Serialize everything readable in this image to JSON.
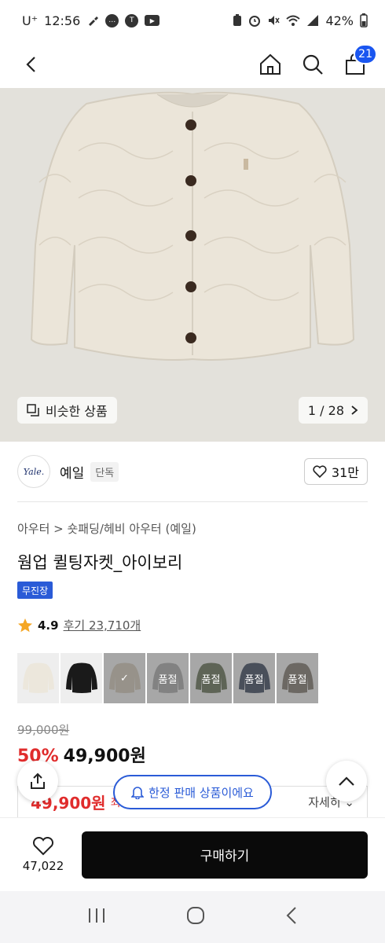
{
  "status": {
    "carrier": "U⁺",
    "time": "12:56",
    "battery": "42%",
    "icons_left": [
      "brush-icon",
      "chat-bubble-icon",
      "talk-icon",
      "youtube-icon"
    ],
    "icons_right": [
      "battery-saver-icon",
      "alarm-icon",
      "mute-icon",
      "wifi-icon",
      "signal-icon",
      "battery-icon"
    ]
  },
  "header": {
    "cart_count": "21"
  },
  "gallery": {
    "similar_label": "비슷한 상품",
    "pager": "1 / 28"
  },
  "brand": {
    "logo_text": "Yale.",
    "name": "예일",
    "tag": "단독",
    "likes": "31만"
  },
  "product": {
    "breadcrumb": "아우터 > 숏패딩/헤비 아우터 (예일)",
    "title": "웜업 퀼팅자켓_아이보리",
    "badge": "무진장",
    "rating": "4.9",
    "reviews": "후기 23,710개"
  },
  "swatches": [
    {
      "color": "#ece7dc",
      "overlay": ""
    },
    {
      "color": "#1a1a1a",
      "overlay": ""
    },
    {
      "color": "#c9bfae",
      "overlay": "✓"
    },
    {
      "color": "#9c9c9c",
      "overlay": "품절"
    },
    {
      "color": "#4d5a3a",
      "overlay": "품절"
    },
    {
      "color": "#1e2a44",
      "overlay": "품절"
    },
    {
      "color": "#6b6257",
      "overlay": "품절"
    }
  ],
  "price": {
    "original": "99,000원",
    "discount": "50%",
    "sale": "49,900원",
    "benefit_price": "49,900원",
    "benefit_label": "최대혜택가",
    "more": "자세히"
  },
  "toast": "한정 판매 상품이에요",
  "bottom": {
    "like_count": "47,022",
    "buy_label": "구매하기"
  },
  "colors": {
    "accent_blue": "#2a5bd7",
    "sale_red": "#e02c2c",
    "buy_black": "#0a0a0a"
  }
}
